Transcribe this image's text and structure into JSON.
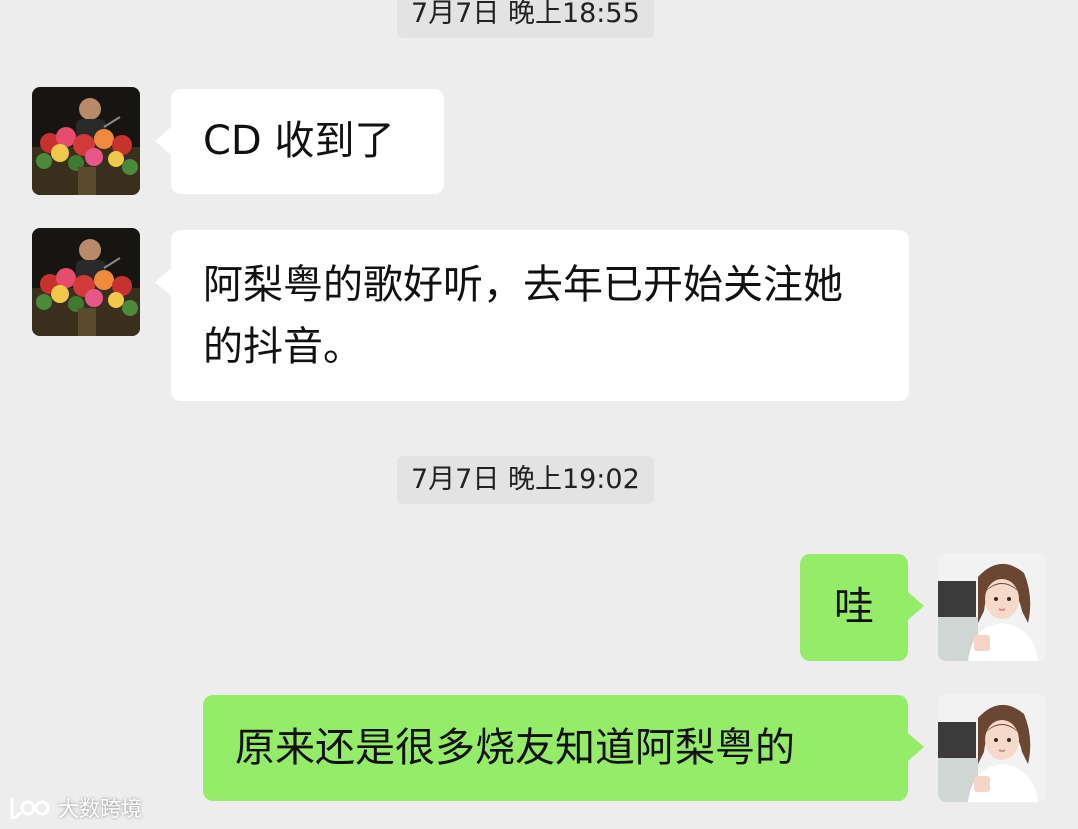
{
  "chat": {
    "timestamps": [
      "7月7日 晚上18:55",
      "7月7日 晚上19:02"
    ],
    "messages": [
      {
        "side": "left",
        "sender": "contact",
        "text": "CD 收到了"
      },
      {
        "side": "left",
        "sender": "contact",
        "text": "阿梨粤的歌好听，去年已开始关注她的抖音。"
      },
      {
        "side": "right",
        "sender": "me",
        "text": "哇"
      },
      {
        "side": "right",
        "sender": "me",
        "text": "原来还是很多烧友知道阿梨粤的"
      }
    ]
  },
  "watermark": {
    "text": "大数跨境",
    "icon": "logo-icon"
  },
  "colors": {
    "background": "#ededed",
    "incoming_bubble": "#ffffff",
    "outgoing_bubble": "#95ec69",
    "timestamp_bg": "#e3e3e3"
  }
}
